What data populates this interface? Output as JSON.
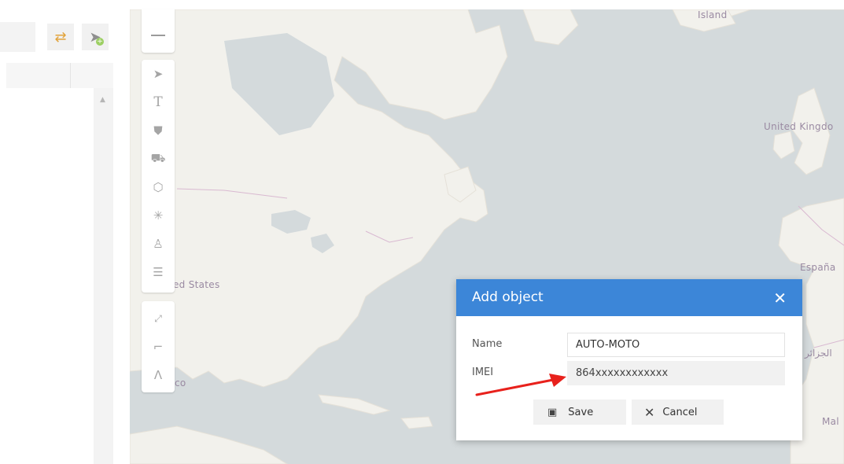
{
  "map": {
    "labels": {
      "island": "Island",
      "united_kingdom": "United Kingdo",
      "espana": "España",
      "united_states": "ed States",
      "mexico": "co",
      "algeria": "الجزائر",
      "mali": "Mal"
    }
  },
  "dialog": {
    "title": "Add object",
    "close_symbol": "✕",
    "fields": {
      "name_label": "Name",
      "name_value": "AUTO-MOTO",
      "imei_label": "IMEI",
      "imei_value": "864xxxxxxxxxxxx"
    },
    "buttons": {
      "save_label": "Save",
      "cancel_label": "Cancel"
    }
  },
  "colors": {
    "dialog_header": "#3c86d8",
    "annotation_arrow": "#e8211c",
    "water": "#d4dadc",
    "land": "#f2f1ec"
  },
  "icons": {
    "toolbar": [
      "locate-arrow-icon",
      "text-icon",
      "shield-icon",
      "road-icon",
      "polygon-icon",
      "spider-icon",
      "person-icon",
      "traffic-light-icon"
    ],
    "toolbar_bottom": [
      "fullscreen-icon",
      "ruler-icon",
      "area-icon"
    ]
  }
}
